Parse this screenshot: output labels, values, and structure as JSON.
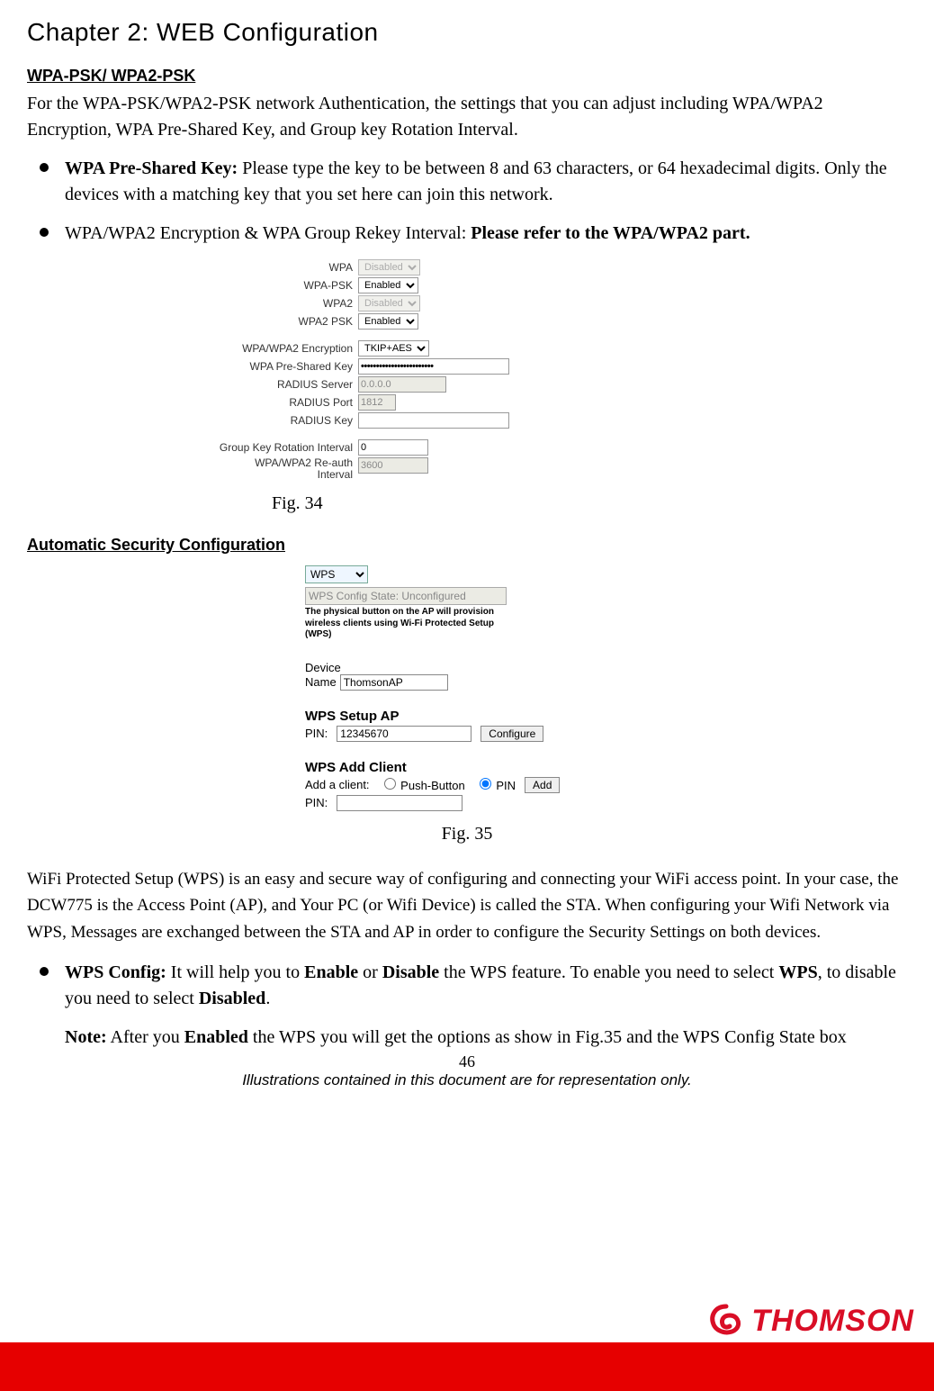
{
  "chapter_title": "Chapter 2: WEB Configuration",
  "section1_heading": "WPA-PSK/ WPA2-PSK",
  "section1_intro": "For the WPA-PSK/WPA2-PSK network Authentication, the settings that you can adjust including WPA/WPA2 Encryption, WPA Pre-Shared Key, and Group key Rotation Interval.",
  "bullet1_label": "WPA Pre-Shared Key:",
  "bullet1_text": " Please type the key to be between 8 and 63 characters, or 64 hexadecimal digits. Only the devices with a matching key that you set here can join this network.",
  "bullet2_prefix": "WPA/WPA2 Encryption & WPA Group Rekey Interval: ",
  "bullet2_bold": "Please refer to the WPA/WPA2 part.",
  "fig34": {
    "wpa_label": "WPA",
    "wpa_value": "Disabled",
    "wpapsk_label": "WPA-PSK",
    "wpapsk_value": "Enabled",
    "wpa2_label": "WPA2",
    "wpa2_value": "Disabled",
    "wpa2psk_label": "WPA2 PSK",
    "wpa2psk_value": "Enabled",
    "enc_label": "WPA/WPA2 Encryption",
    "enc_value": "TKIP+AES",
    "psk_label": "WPA Pre-Shared Key",
    "psk_value": "••••••••••••••••••••••••",
    "radius_server_label": "RADIUS Server",
    "radius_server_value": "0.0.0.0",
    "radius_port_label": "RADIUS Port",
    "radius_port_value": "1812",
    "radius_key_label": "RADIUS Key",
    "radius_key_value": "",
    "group_key_label": "Group Key Rotation Interval",
    "group_key_value": "0",
    "reauth_label_line1": "WPA/WPA2 Re-auth",
    "reauth_label_line2": "Interval",
    "reauth_value": "3600"
  },
  "fig34_caption": "Fig. 34",
  "section2_heading": "Automatic Security Configuration",
  "fig35": {
    "wps_select": "WPS",
    "status_box": "WPS Config State: Unconfigured",
    "desc": "The physical button on the AP will provision wireless clients using Wi-Fi Protected Setup (WPS)",
    "device_label1": "Device",
    "device_label2": "Name",
    "device_name_value": "ThomsonAP",
    "setup_ap_heading": "WPS Setup AP",
    "pin_label": "PIN:",
    "pin_value": "12345670",
    "configure_btn": "Configure",
    "add_client_heading": "WPS Add Client",
    "add_client_label": "Add a client:",
    "push_button_label": "Push-Button",
    "pin_radio_label": "PIN",
    "add_btn": "Add",
    "client_pin_label": "PIN:",
    "client_pin_value": ""
  },
  "fig35_caption": "Fig. 35",
  "wps_para": "WiFi Protected Setup (WPS) is an easy and secure way of configuring and connecting your WiFi access point. In your case, the DCW775 is the Access Point (AP), and Your PC (or Wifi Device) is called the STA.   When configuring your Wifi Network via WPS, Messages are exchanged between the STA and AP in order to configure the Security Settings on both devices.",
  "wps_config_label": "WPS Config:",
  "wps_config_text_a": " It will help you to ",
  "wps_config_enable": "Enable",
  "wps_config_text_b": " or ",
  "wps_config_disable": "Disable",
  "wps_config_text_c": " the WPS feature. To enable you need to select ",
  "wps_config_wps": "WPS",
  "wps_config_text_d": ", to disable you need to select ",
  "wps_config_disabled": "Disabled",
  "wps_config_text_e": ".",
  "note_label": "Note:",
  "note_text_a": " After you ",
  "note_enabled": "Enabled",
  "note_text_b": " the WPS you will get the options as show in Fig.35 and the WPS Config State box",
  "page_number": "46",
  "footer_note": "Illustrations contained in this document are for representation only.",
  "logo_text": "THOMSON"
}
